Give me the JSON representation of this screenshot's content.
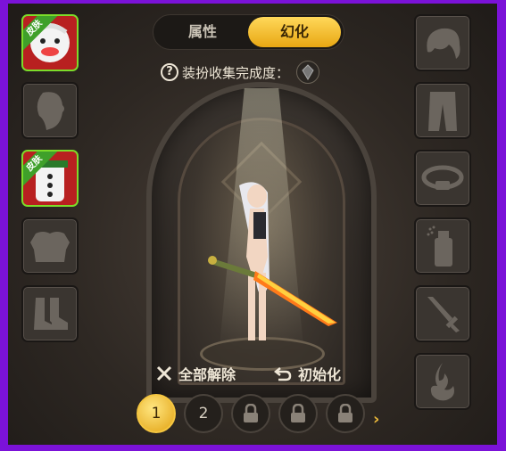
{
  "tabs": {
    "attributes": "属性",
    "transform": "幻化"
  },
  "collection": {
    "label": "装扮收集完成度："
  },
  "left_slots": [
    {
      "name": "hair-skin",
      "skin": true,
      "tag": "皮肤"
    },
    {
      "name": "face",
      "skin": false
    },
    {
      "name": "top-skin",
      "skin": true,
      "tag": "皮肤"
    },
    {
      "name": "chest",
      "skin": false
    },
    {
      "name": "shoes",
      "skin": false
    }
  ],
  "right_slots": [
    "hair",
    "pants",
    "belt",
    "spray",
    "sword",
    "aura"
  ],
  "actions": {
    "remove_all": "全部解除",
    "reset": "初始化"
  },
  "pages": [
    "1",
    "2"
  ],
  "colors": {
    "accent": "#f5c640",
    "skin_border": "#7cdc2a",
    "frame": "#7b12d8"
  }
}
